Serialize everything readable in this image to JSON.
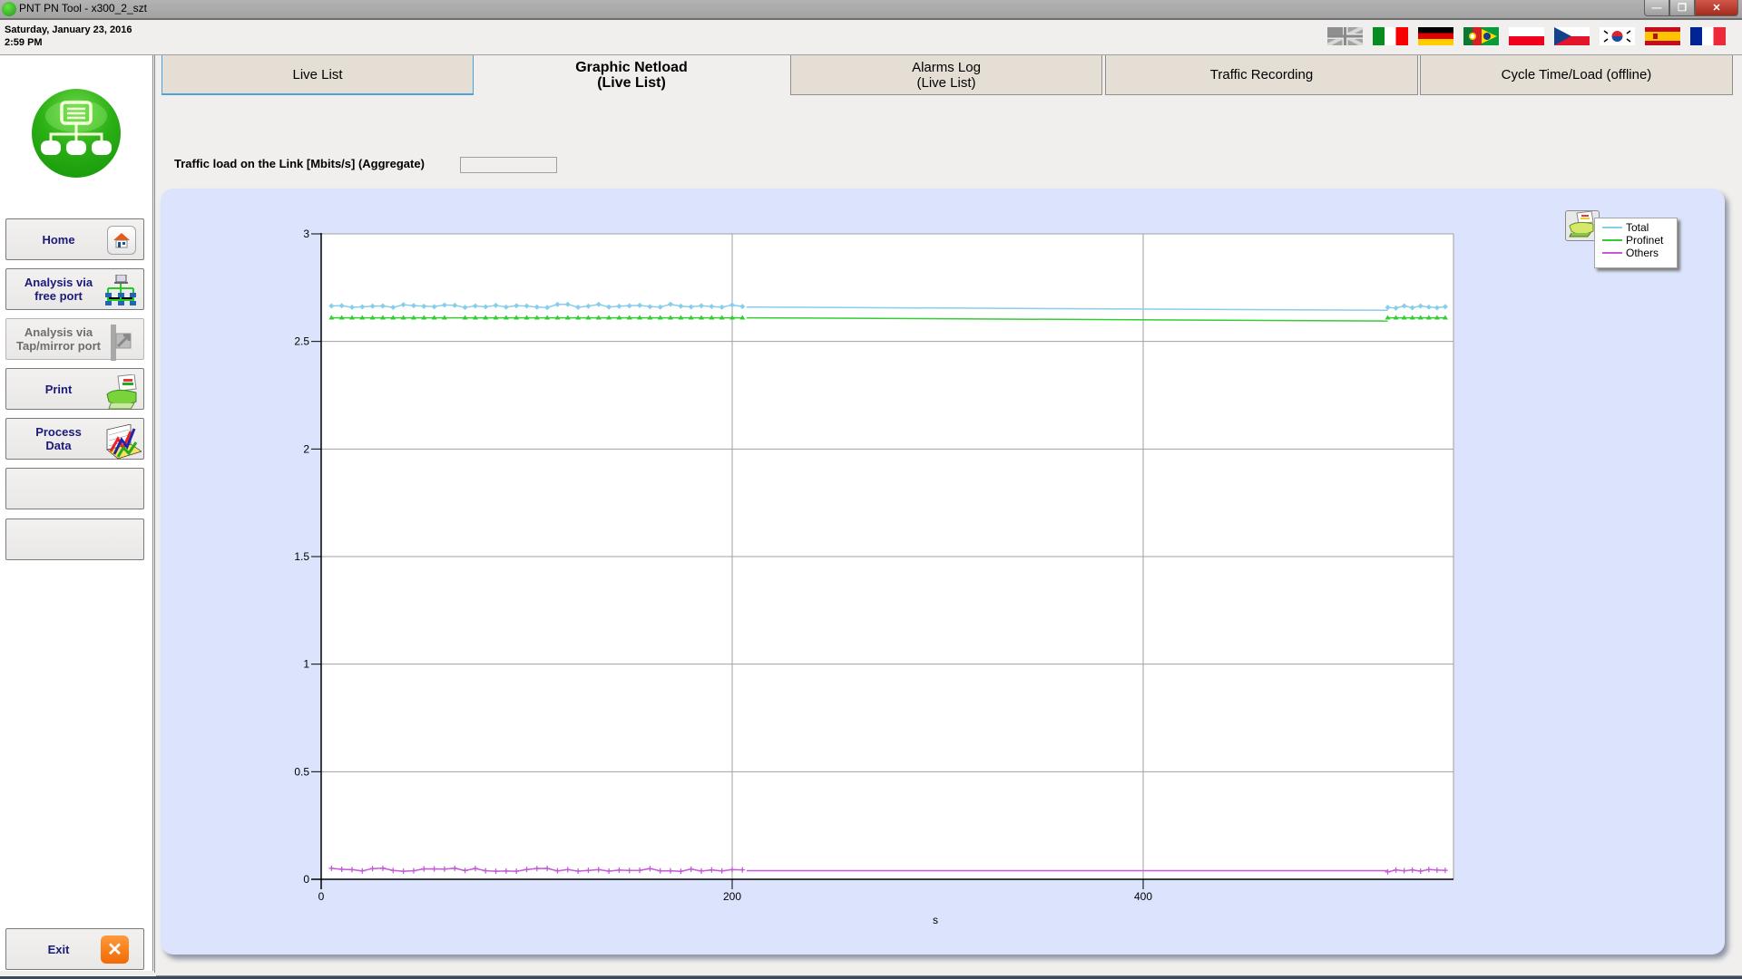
{
  "window": {
    "title": "PNT PN Tool - x300_2_szt",
    "controls": {
      "minimize": "—",
      "restore": "❐",
      "close": "✕"
    }
  },
  "datetime": {
    "date": "Saturday, January 23, 2016",
    "time": "2:59 PM"
  },
  "languages": [
    {
      "name": "english-flag",
      "selected": false
    },
    {
      "name": "italian-flag"
    },
    {
      "name": "german-flag"
    },
    {
      "name": "portuguese-brazilian-flag"
    },
    {
      "name": "polish-flag"
    },
    {
      "name": "czech-flag"
    },
    {
      "name": "korean-flag"
    },
    {
      "name": "spanish-flag"
    },
    {
      "name": "french-flag"
    }
  ],
  "sidebar": {
    "logo": "network-logo-icon",
    "items": [
      {
        "label": "Home",
        "icon": "home-icon",
        "enabled": true
      },
      {
        "label": "Analysis via\nfree port",
        "icon": "network-topology-icon",
        "enabled": true
      },
      {
        "label": "Analysis via\nTap/mirror port",
        "icon": "tap-port-icon",
        "enabled": false
      },
      {
        "label": "Print",
        "icon": "printer-icon",
        "enabled": true
      },
      {
        "label": "Process\nData",
        "icon": "3d-chart-icon",
        "enabled": true
      },
      {
        "label": "",
        "enabled": true
      },
      {
        "label": "",
        "enabled": true
      }
    ],
    "exit": {
      "label": "Exit",
      "icon": "close-icon"
    }
  },
  "tabs": [
    {
      "label": "Live List",
      "active": false
    },
    {
      "label": "Graphic Netload\n(Live List)",
      "active": true
    },
    {
      "label": "Alarms Log\n(Live List)",
      "active": false
    },
    {
      "label": "Traffic Recording",
      "active": false
    },
    {
      "label": "Cycle Time/Load (offline)",
      "active": false
    }
  ],
  "load_field": {
    "label": "Traffic load on the Link [Mbits/s] (Aggregate)",
    "value": ""
  },
  "colors": {
    "total": "#87ceeb",
    "profinet": "#32cd32",
    "others": "#c45ad8",
    "panel": "#dbe4fc"
  },
  "chart_data": {
    "type": "line",
    "title": "",
    "xlabel": "s",
    "ylabel": "",
    "xlim": [
      0,
      551
    ],
    "ylim": [
      0,
      3
    ],
    "xticks": [
      0,
      200,
      400
    ],
    "yticks": [
      0,
      0.5,
      1,
      1.5,
      2,
      2.5,
      3
    ],
    "ytick_labels": [
      "0",
      "0.5",
      "1",
      "1.5",
      "2",
      "2.5",
      "3"
    ],
    "xtick_labels": [
      "0",
      "200",
      "400"
    ],
    "grid": true,
    "legend": {
      "position": "top-right",
      "entries": [
        "Total",
        "Profinet",
        "Others"
      ]
    },
    "series": [
      {
        "name": "Total",
        "marker": "diamond",
        "segments": [
          {
            "x_start": 5,
            "x_end": 207,
            "step": 5,
            "value": 2.665,
            "jitter": 0.008
          },
          {
            "points": [
              [
                207,
                2.66
              ],
              [
                519,
                2.645
              ]
            ]
          },
          {
            "x_start": 519,
            "x_end": 549,
            "step": 4,
            "value": 2.66,
            "jitter": 0.006
          }
        ]
      },
      {
        "name": "Profinet",
        "marker": "triangle",
        "segments": [
          {
            "x_start": 5,
            "x_end": 207,
            "step": 5,
            "value": 2.61,
            "jitter": 0.0,
            "missing": [
              65
            ]
          },
          {
            "points": [
              [
                207,
                2.61
              ],
              [
                519,
                2.595
              ]
            ]
          },
          {
            "x_start": 519,
            "x_end": 549,
            "step": 4,
            "value": 2.61,
            "jitter": 0.0
          }
        ]
      },
      {
        "name": "Others",
        "marker": "plus",
        "segments": [
          {
            "x_start": 5,
            "x_end": 207,
            "step": 5,
            "value": 0.045,
            "jitter": 0.008
          },
          {
            "points": [
              [
                207,
                0.04
              ],
              [
                519,
                0.04
              ]
            ]
          },
          {
            "x_start": 519,
            "x_end": 549,
            "step": 4,
            "value": 0.04,
            "jitter": 0.006
          }
        ]
      }
    ]
  }
}
